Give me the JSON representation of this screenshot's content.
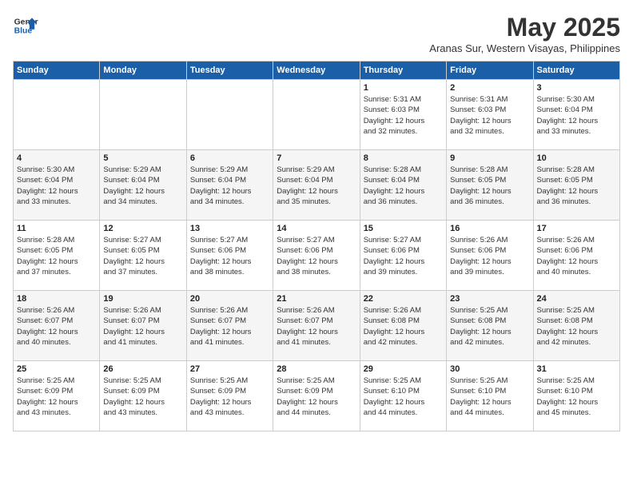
{
  "logo": {
    "line1": "General",
    "line2": "Blue"
  },
  "title": "May 2025",
  "subtitle": "Aranas Sur, Western Visayas, Philippines",
  "columns": [
    "Sunday",
    "Monday",
    "Tuesday",
    "Wednesday",
    "Thursday",
    "Friday",
    "Saturday"
  ],
  "weeks": [
    [
      {
        "day": "",
        "detail": ""
      },
      {
        "day": "",
        "detail": ""
      },
      {
        "day": "",
        "detail": ""
      },
      {
        "day": "",
        "detail": ""
      },
      {
        "day": "1",
        "detail": "Sunrise: 5:31 AM\nSunset: 6:03 PM\nDaylight: 12 hours\nand 32 minutes."
      },
      {
        "day": "2",
        "detail": "Sunrise: 5:31 AM\nSunset: 6:03 PM\nDaylight: 12 hours\nand 32 minutes."
      },
      {
        "day": "3",
        "detail": "Sunrise: 5:30 AM\nSunset: 6:04 PM\nDaylight: 12 hours\nand 33 minutes."
      }
    ],
    [
      {
        "day": "4",
        "detail": "Sunrise: 5:30 AM\nSunset: 6:04 PM\nDaylight: 12 hours\nand 33 minutes."
      },
      {
        "day": "5",
        "detail": "Sunrise: 5:29 AM\nSunset: 6:04 PM\nDaylight: 12 hours\nand 34 minutes."
      },
      {
        "day": "6",
        "detail": "Sunrise: 5:29 AM\nSunset: 6:04 PM\nDaylight: 12 hours\nand 34 minutes."
      },
      {
        "day": "7",
        "detail": "Sunrise: 5:29 AM\nSunset: 6:04 PM\nDaylight: 12 hours\nand 35 minutes."
      },
      {
        "day": "8",
        "detail": "Sunrise: 5:28 AM\nSunset: 6:04 PM\nDaylight: 12 hours\nand 36 minutes."
      },
      {
        "day": "9",
        "detail": "Sunrise: 5:28 AM\nSunset: 6:05 PM\nDaylight: 12 hours\nand 36 minutes."
      },
      {
        "day": "10",
        "detail": "Sunrise: 5:28 AM\nSunset: 6:05 PM\nDaylight: 12 hours\nand 36 minutes."
      }
    ],
    [
      {
        "day": "11",
        "detail": "Sunrise: 5:28 AM\nSunset: 6:05 PM\nDaylight: 12 hours\nand 37 minutes."
      },
      {
        "day": "12",
        "detail": "Sunrise: 5:27 AM\nSunset: 6:05 PM\nDaylight: 12 hours\nand 37 minutes."
      },
      {
        "day": "13",
        "detail": "Sunrise: 5:27 AM\nSunset: 6:06 PM\nDaylight: 12 hours\nand 38 minutes."
      },
      {
        "day": "14",
        "detail": "Sunrise: 5:27 AM\nSunset: 6:06 PM\nDaylight: 12 hours\nand 38 minutes."
      },
      {
        "day": "15",
        "detail": "Sunrise: 5:27 AM\nSunset: 6:06 PM\nDaylight: 12 hours\nand 39 minutes."
      },
      {
        "day": "16",
        "detail": "Sunrise: 5:26 AM\nSunset: 6:06 PM\nDaylight: 12 hours\nand 39 minutes."
      },
      {
        "day": "17",
        "detail": "Sunrise: 5:26 AM\nSunset: 6:06 PM\nDaylight: 12 hours\nand 40 minutes."
      }
    ],
    [
      {
        "day": "18",
        "detail": "Sunrise: 5:26 AM\nSunset: 6:07 PM\nDaylight: 12 hours\nand 40 minutes."
      },
      {
        "day": "19",
        "detail": "Sunrise: 5:26 AM\nSunset: 6:07 PM\nDaylight: 12 hours\nand 41 minutes."
      },
      {
        "day": "20",
        "detail": "Sunrise: 5:26 AM\nSunset: 6:07 PM\nDaylight: 12 hours\nand 41 minutes."
      },
      {
        "day": "21",
        "detail": "Sunrise: 5:26 AM\nSunset: 6:07 PM\nDaylight: 12 hours\nand 41 minutes."
      },
      {
        "day": "22",
        "detail": "Sunrise: 5:26 AM\nSunset: 6:08 PM\nDaylight: 12 hours\nand 42 minutes."
      },
      {
        "day": "23",
        "detail": "Sunrise: 5:25 AM\nSunset: 6:08 PM\nDaylight: 12 hours\nand 42 minutes."
      },
      {
        "day": "24",
        "detail": "Sunrise: 5:25 AM\nSunset: 6:08 PM\nDaylight: 12 hours\nand 42 minutes."
      }
    ],
    [
      {
        "day": "25",
        "detail": "Sunrise: 5:25 AM\nSunset: 6:09 PM\nDaylight: 12 hours\nand 43 minutes."
      },
      {
        "day": "26",
        "detail": "Sunrise: 5:25 AM\nSunset: 6:09 PM\nDaylight: 12 hours\nand 43 minutes."
      },
      {
        "day": "27",
        "detail": "Sunrise: 5:25 AM\nSunset: 6:09 PM\nDaylight: 12 hours\nand 43 minutes."
      },
      {
        "day": "28",
        "detail": "Sunrise: 5:25 AM\nSunset: 6:09 PM\nDaylight: 12 hours\nand 44 minutes."
      },
      {
        "day": "29",
        "detail": "Sunrise: 5:25 AM\nSunset: 6:10 PM\nDaylight: 12 hours\nand 44 minutes."
      },
      {
        "day": "30",
        "detail": "Sunrise: 5:25 AM\nSunset: 6:10 PM\nDaylight: 12 hours\nand 44 minutes."
      },
      {
        "day": "31",
        "detail": "Sunrise: 5:25 AM\nSunset: 6:10 PM\nDaylight: 12 hours\nand 45 minutes."
      }
    ]
  ]
}
